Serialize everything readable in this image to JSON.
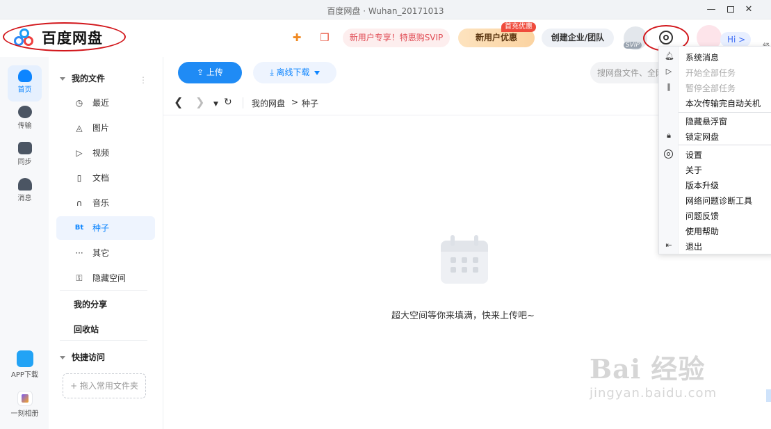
{
  "window": {
    "title": "百度网盘 · Wuhan_20171013",
    "minimize": "—",
    "close": "✕"
  },
  "header": {
    "logo_text": "百度网盘",
    "svip_promo": "新用户专享！特惠购SVIP",
    "new_user_btn": "新用户优惠",
    "new_user_tag": "首充优惠",
    "enterprise_btn": "创建企业/团队",
    "svip_badge": "SVIP",
    "hi": "Hi >",
    "edge_text": "经"
  },
  "rail": {
    "home": "首页",
    "transfer": "传输",
    "sync": "同步",
    "message": "消息",
    "app_download": "APP下载",
    "album": "一刻相册"
  },
  "nav": {
    "my_files": "我的文件",
    "items": [
      {
        "icon": "◷",
        "label": "最近"
      },
      {
        "icon": "◬",
        "label": "图片"
      },
      {
        "icon": "▷",
        "label": "视频"
      },
      {
        "icon": "▯",
        "label": "文档"
      },
      {
        "icon": "∩",
        "label": "音乐"
      },
      {
        "icon": "Bt",
        "label": "种子"
      },
      {
        "icon": "···",
        "label": "其它"
      },
      {
        "icon": "⚿",
        "label": "隐藏空间"
      }
    ],
    "my_share": "我的分享",
    "recycle": "回收站",
    "quick_access": "快捷访问",
    "drop_hint": "+ 拖入常用文件夹"
  },
  "toolbar": {
    "upload": "上传",
    "offline": "离线下载",
    "search_placeholder": "搜网盘文件、全网"
  },
  "path": {
    "root": "我的网盘",
    "separator": ">",
    "current": "种子"
  },
  "empty": {
    "text": "超大空间等你来填满，快来上传吧~"
  },
  "menu": {
    "items": [
      {
        "label": "系统消息",
        "enabled": true
      },
      {
        "label": "开始全部任务",
        "enabled": false
      },
      {
        "label": "暂停全部任务",
        "enabled": false
      },
      {
        "label": "本次传输完自动关机",
        "enabled": true
      },
      {
        "label": "隐藏悬浮窗",
        "enabled": true
      },
      {
        "label": "锁定网盘",
        "enabled": true
      },
      {
        "label": "设置",
        "enabled": true
      },
      {
        "label": "关于",
        "enabled": true
      },
      {
        "label": "版本升级",
        "enabled": true
      },
      {
        "label": "网络问题诊断工具",
        "enabled": true
      },
      {
        "label": "问题反馈",
        "enabled": true
      },
      {
        "label": "使用帮助",
        "enabled": true
      },
      {
        "label": "退出",
        "enabled": true
      }
    ]
  },
  "watermark": {
    "brand": "Bai 经验",
    "url": "jingyan.baidu.com"
  },
  "colors": {
    "accent": "#0d85ff",
    "annotation": "#d2161b",
    "promo": "#e04b54"
  }
}
